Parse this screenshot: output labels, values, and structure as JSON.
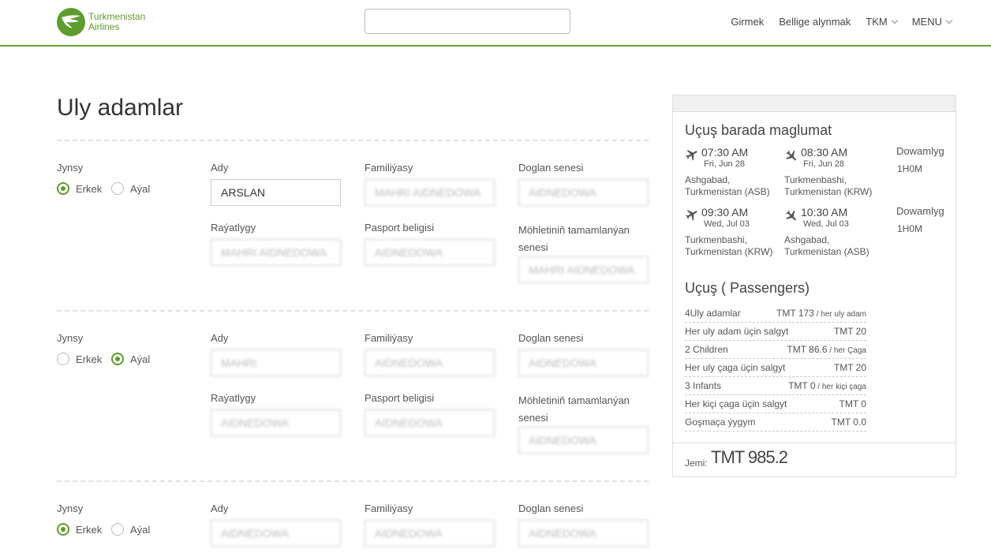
{
  "header": {
    "logo_line1": "Turkmenistan",
    "logo_line2": "Airlines",
    "search_value": "",
    "nav": [
      "Girmek",
      "Bellige alynmak",
      "TKM",
      "MENU"
    ],
    "accent": "#5d9c2d"
  },
  "title": "Uly adamlar",
  "labels": {
    "gender": "Jynsy",
    "male": "Erkek",
    "female": "Aýal",
    "first_name": "Ady",
    "last_name": "Familiýasy",
    "birth": "Doglan senesi",
    "nationality": "Raýatlygy",
    "passport": "Pasport beligisi",
    "expiry": "Möhletiniň tamamlanýan senesi"
  },
  "passengers": [
    {
      "gender": "male",
      "first_name": "ARSLAN",
      "last_name": "MAHRI AIDNEDOWA",
      "birth": "AIDNEDOWA",
      "nationality": "MAHRI AIDNEDOWA",
      "passport": "AIDNEDOWA",
      "expiry": "MAHRI AIDNEDOWA"
    },
    {
      "gender": "female",
      "first_name": "MAHRI",
      "last_name": "AIDNEDOWA",
      "birth": "AIDNEDOWA",
      "nationality": "AIDNEDOWA",
      "passport": "AIDNEDOWA",
      "expiry": "AIDNEDOWA"
    },
    {
      "gender": "male",
      "first_name": "AIDNEDOWA",
      "last_name": "AIDNEDOWA",
      "birth": "AIDNEDOWA"
    }
  ],
  "sidebar": {
    "flight_title": "Uçuş barada maglumat",
    "duration_label": "Dowamlyg",
    "segments": [
      {
        "dep_time": "07:30 AM",
        "dep_date": "Fri, Jun 28",
        "dep_city1": "Ashgabad,",
        "dep_city2": "Turkmenistan (ASB)",
        "arr_time": "08:30 AM",
        "arr_date": "Fri, Jun 28",
        "arr_city1": "Turkmenbashi,",
        "arr_city2": "Turkmenistan (KRW)",
        "duration": "1H0M"
      },
      {
        "dep_time": "09:30 AM",
        "dep_date": "Wed, Jul 03",
        "dep_city1": "Turkmenbashi,",
        "dep_city2": "Turkmenistan (KRW)",
        "arr_time": "10:30 AM",
        "arr_date": "Wed, Jul 03",
        "arr_city1": "Ashgabad,",
        "arr_city2": "Turkmenistan (ASB)",
        "duration": "1H0M"
      }
    ],
    "pass_title": "Uçuş ( Passengers)",
    "price_rows": [
      {
        "label": "4Uly adamlar",
        "value": "TMT 173",
        "suffix": " / her uly adam"
      },
      {
        "label": "Her uly adam üçin salgyt",
        "value": "TMT 20",
        "suffix": ""
      },
      {
        "label": "2 Children",
        "value": "TMT 86.6",
        "suffix": " / her Çaga"
      },
      {
        "label": "Her uly çaga üçin salgyt",
        "value": "TMT 20",
        "suffix": ""
      },
      {
        "label": "3 Infants",
        "value": "TMT 0",
        "suffix": " / her kiçi çaga"
      },
      {
        "label": "Her kiçi çaga üçin salgyt",
        "value": "TMT 0",
        "suffix": ""
      },
      {
        "label": "Goşmaça ýygym",
        "value": "TMT 0.0",
        "suffix": ""
      }
    ],
    "total_label": "Jemi:",
    "total_value": "TMT 985.2"
  }
}
